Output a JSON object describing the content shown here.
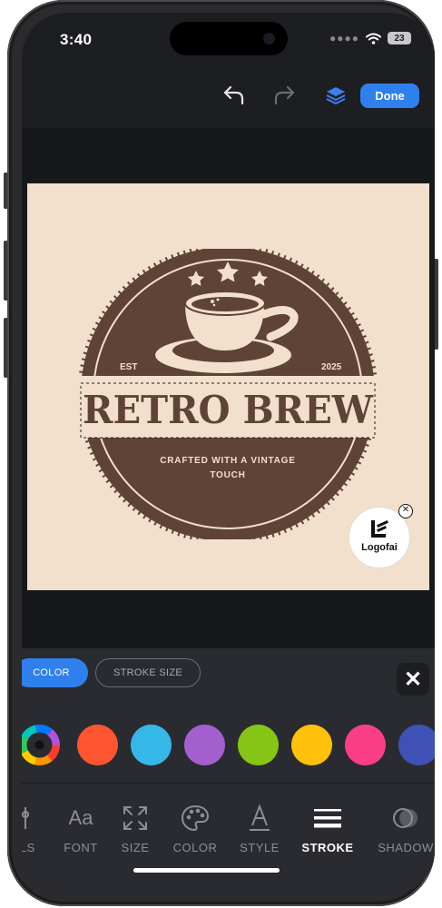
{
  "status_bar": {
    "time": "3:40",
    "battery": "23"
  },
  "toolbar": {
    "done_label": "Done"
  },
  "logo": {
    "title": "RETRO BREW",
    "est_label": "EST",
    "year": "2025",
    "tagline_line1": "CRAFTED WITH A VINTAGE",
    "tagline_line2": "TOUCH",
    "colors": {
      "badge": "#5e4336",
      "background": "#f2e0cd"
    }
  },
  "watermark": {
    "label": "Logofai"
  },
  "panel": {
    "chips": {
      "color": "COLOR",
      "stroke_size": "STROKE SIZE"
    },
    "swatches": [
      "#fe5430",
      "#35b8e8",
      "#a45fcf",
      "#86c515",
      "#ffc10a",
      "#fb3f84",
      "#3f51b5"
    ],
    "tabs": {
      "controls": "ROLS",
      "font": "FONT",
      "size": "SIZE",
      "color": "COLOR",
      "style": "STYLE",
      "stroke": "STROKE",
      "shadow": "SHADOW"
    },
    "font_icon_text": "Aa",
    "accent": "#2f80ed"
  }
}
